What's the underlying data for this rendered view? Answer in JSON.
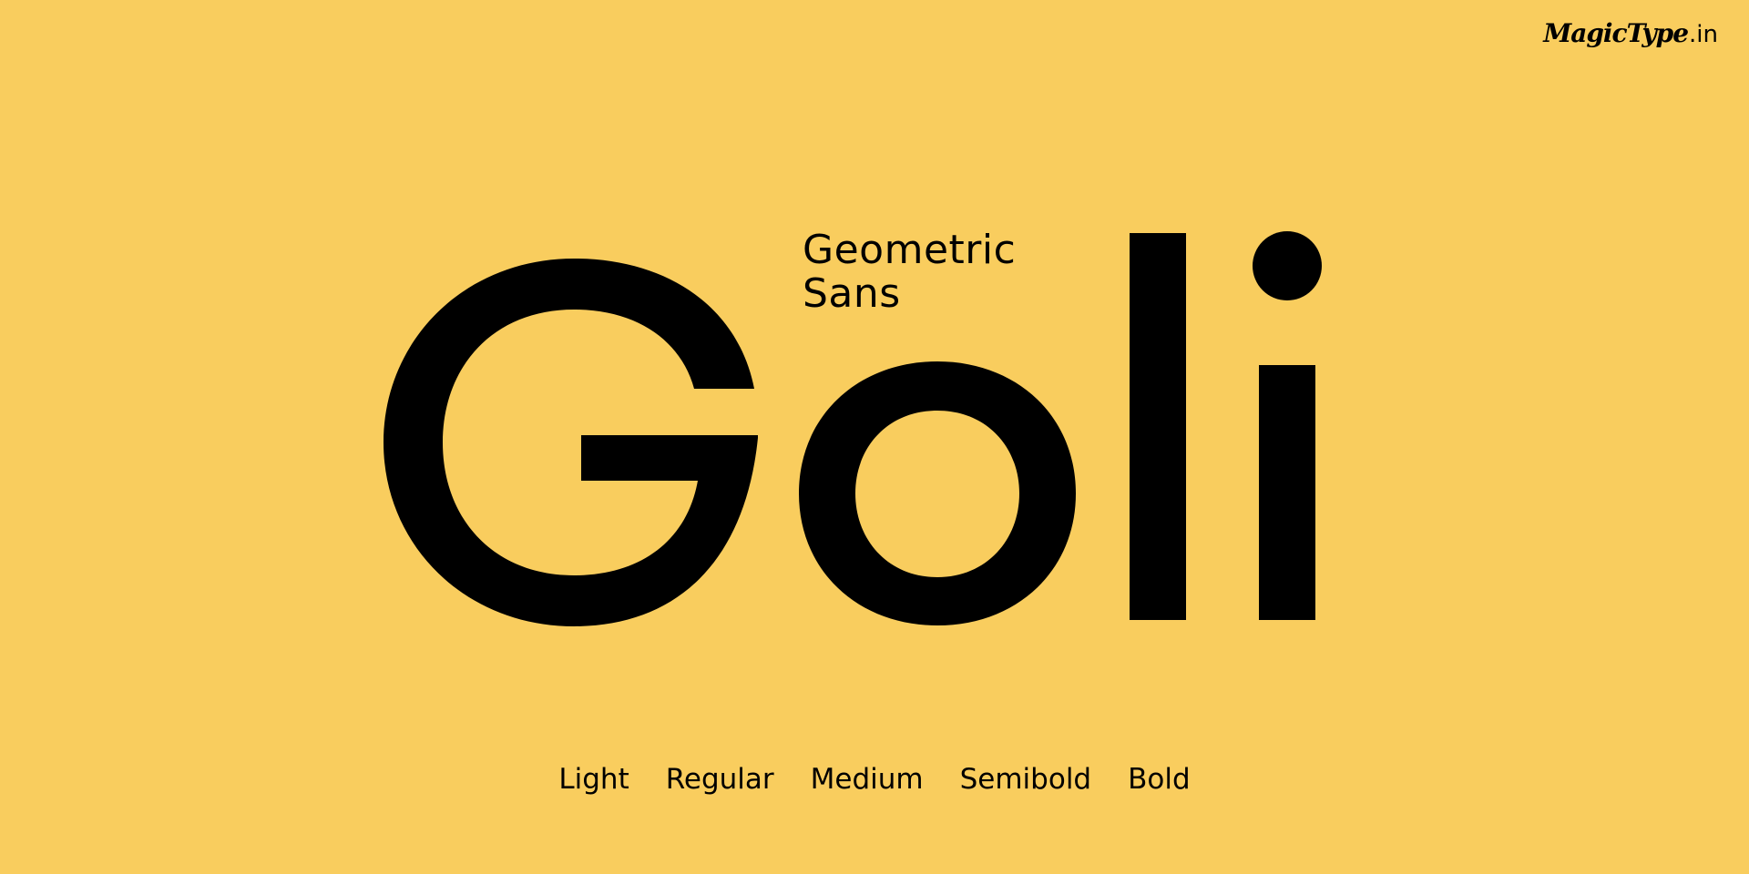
{
  "colors": {
    "background": "#F9CD5E",
    "ink": "#000000"
  },
  "logo": {
    "name": "MagicType",
    "tld": ".in"
  },
  "specimen": {
    "word": "Goli",
    "category_line1": "Geometric",
    "category_line2": "Sans"
  },
  "weights": [
    "Light",
    "Regular",
    "Medium",
    "Semibold",
    "Bold"
  ]
}
